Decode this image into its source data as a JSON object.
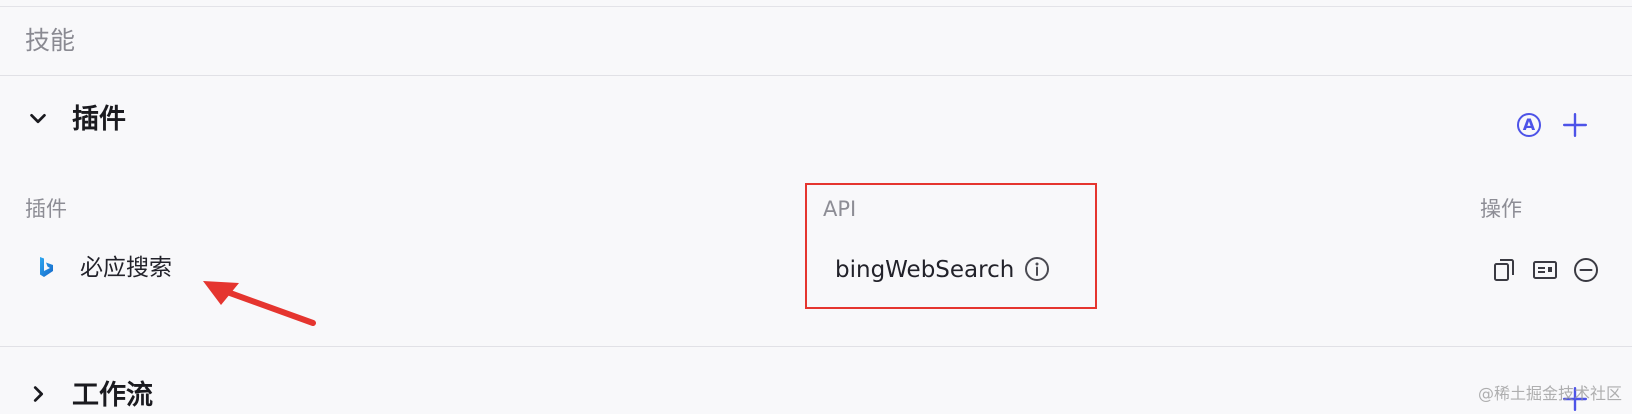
{
  "skills": {
    "title": "技能"
  },
  "plugins_section": {
    "title": "插件",
    "expanded": true,
    "auto_badge_label": "A",
    "columns": {
      "plugin": "插件",
      "api": "API",
      "actions": "操作"
    },
    "rows": [
      {
        "icon": "bing-logo-icon",
        "logo_letter": "b",
        "name": "必应搜索",
        "api": "bingWebSearch"
      }
    ]
  },
  "workflow_section": {
    "title": "工作流",
    "expanded": false
  },
  "watermark": "@稀土掘金技术社区",
  "colors": {
    "accent": "#4d53e8",
    "annotation": "#e5352f",
    "background": "#f8f8fa"
  }
}
